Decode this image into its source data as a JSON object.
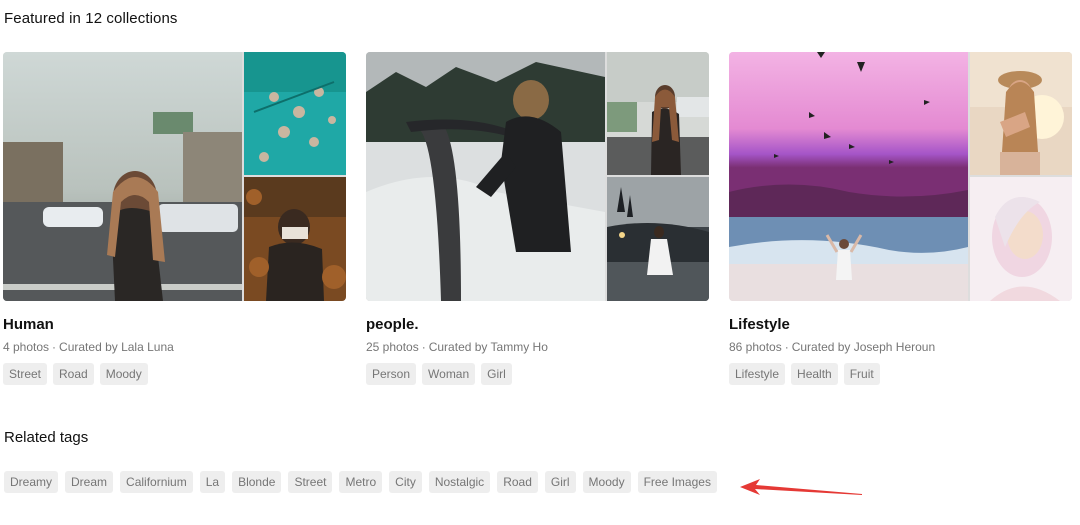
{
  "featured": {
    "heading": "Featured in 12 collections"
  },
  "collections": [
    {
      "title": "Human",
      "photo_count": "4 photos",
      "separator": "·",
      "curated_by": "Curated by Lala Luna",
      "tags": [
        "Street",
        "Road",
        "Moody"
      ]
    },
    {
      "title": "people.",
      "photo_count": "25 photos",
      "separator": "·",
      "curated_by": "Curated by Tammy Ho",
      "tags": [
        "Person",
        "Woman",
        "Girl"
      ]
    },
    {
      "title": "Lifestyle",
      "photo_count": "86 photos",
      "separator": "·",
      "curated_by": "Curated by Joseph Heroun",
      "tags": [
        "Lifestyle",
        "Health",
        "Fruit"
      ]
    }
  ],
  "related": {
    "heading": "Related tags",
    "tags": [
      "Dreamy",
      "Dream",
      "Californium",
      "La",
      "Blonde",
      "Street",
      "Metro",
      "City",
      "Nostalgic",
      "Road",
      "Girl",
      "Moody",
      "Free Images"
    ]
  },
  "colors": {
    "tag_background": "#eeeeee",
    "tag_text": "#767676",
    "annotation_arrow": "#e53935"
  }
}
